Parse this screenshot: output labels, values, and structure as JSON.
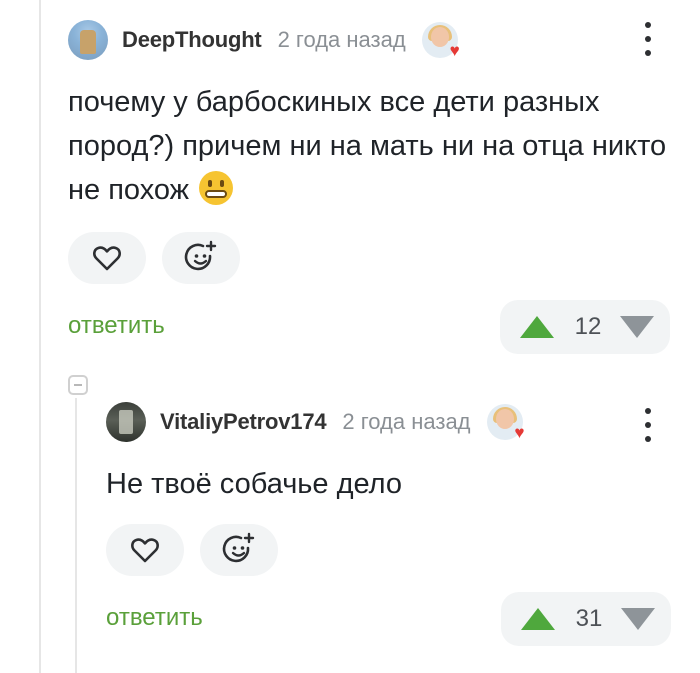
{
  "comments": [
    {
      "username": "DeepThought",
      "time": "2 года назад",
      "text": "почему у барбоскиных все дети разных пород?) причем ни на мать ни на отца никто не похож",
      "emoji": "grimacing-face-emoji",
      "reply_label": "ответить",
      "rating": "12",
      "award_icon": "award-avatar-heart-icon"
    },
    {
      "username": "VitaliyPetrov174",
      "time": "2 года назад",
      "text": "Не твоё собачье дело",
      "reply_label": "ответить",
      "rating": "31",
      "award_icon": "award-avatar-heart-icon"
    }
  ],
  "colors": {
    "accent_green": "#5aa03a",
    "upvote": "#4fa83d",
    "downvote": "#8e9499",
    "pill_bg": "#f2f4f5"
  }
}
